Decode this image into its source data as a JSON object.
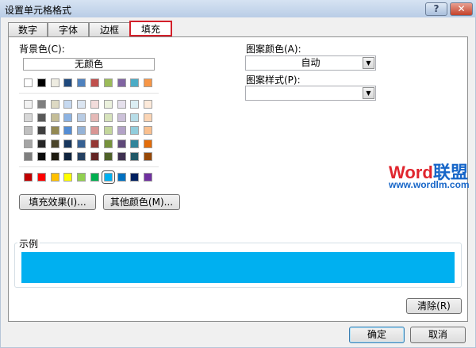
{
  "window": {
    "title": "设置单元格格式",
    "help": "?",
    "close": "✕"
  },
  "tabs": [
    {
      "label": "数字"
    },
    {
      "label": "字体"
    },
    {
      "label": "边框"
    },
    {
      "label": "填充",
      "active": true
    }
  ],
  "fill": {
    "background_label": "背景色(C):",
    "no_color": "无颜色",
    "theme_base": [
      "#FFFFFF",
      "#000000",
      "#EEECE1",
      "#1F497D",
      "#4F81BD",
      "#C0504D",
      "#9BBB59",
      "#8064A2",
      "#4BACC6",
      "#F79646"
    ],
    "theme_tints": [
      [
        "#F2F2F2",
        "#7F7F7F",
        "#DDD9C3",
        "#C6D9F0",
        "#DBE5F1",
        "#F2DCDB",
        "#EBF1DD",
        "#E5E0EC",
        "#DBEEF3",
        "#FDEADA"
      ],
      [
        "#D8D8D8",
        "#595959",
        "#C4BD97",
        "#8DB3E2",
        "#B8CCE4",
        "#E5B9B7",
        "#D7E3BC",
        "#CCC1D9",
        "#B7DDE8",
        "#FBD5B5"
      ],
      [
        "#BFBFBF",
        "#3F3F3F",
        "#938953",
        "#548DD4",
        "#95B3D7",
        "#D99694",
        "#C3D69B",
        "#B2A2C7",
        "#92CDDC",
        "#FAC08F"
      ],
      [
        "#A5A5A5",
        "#262626",
        "#494429",
        "#17365D",
        "#366092",
        "#953734",
        "#76923C",
        "#5F497A",
        "#31859B",
        "#E36C09"
      ],
      [
        "#7F7F7F",
        "#0C0C0C",
        "#1D1B10",
        "#0F243E",
        "#244061",
        "#632423",
        "#4F6128",
        "#3F3151",
        "#205867",
        "#974806"
      ]
    ],
    "standard": [
      "#C00000",
      "#FF0000",
      "#FFC000",
      "#FFFF00",
      "#92D050",
      "#00B050",
      "#00B0F0",
      "#0070C0",
      "#002060",
      "#7030A0"
    ],
    "selected_standard_index": 6,
    "fill_effects": "填充效果(I)...",
    "more_colors": "其他颜色(M)...",
    "pattern_color_label": "图案颜色(A):",
    "pattern_color_value": "自动",
    "pattern_style_label": "图案样式(P):",
    "pattern_style_value": "",
    "sample_label": "示例",
    "sample_color": "#00B0F0",
    "clear": "清除(R)"
  },
  "watermark": {
    "word": "Word",
    "cn": "联盟",
    "url": "www.wordlm.com"
  },
  "footer": {
    "ok": "确定",
    "cancel": "取消"
  }
}
